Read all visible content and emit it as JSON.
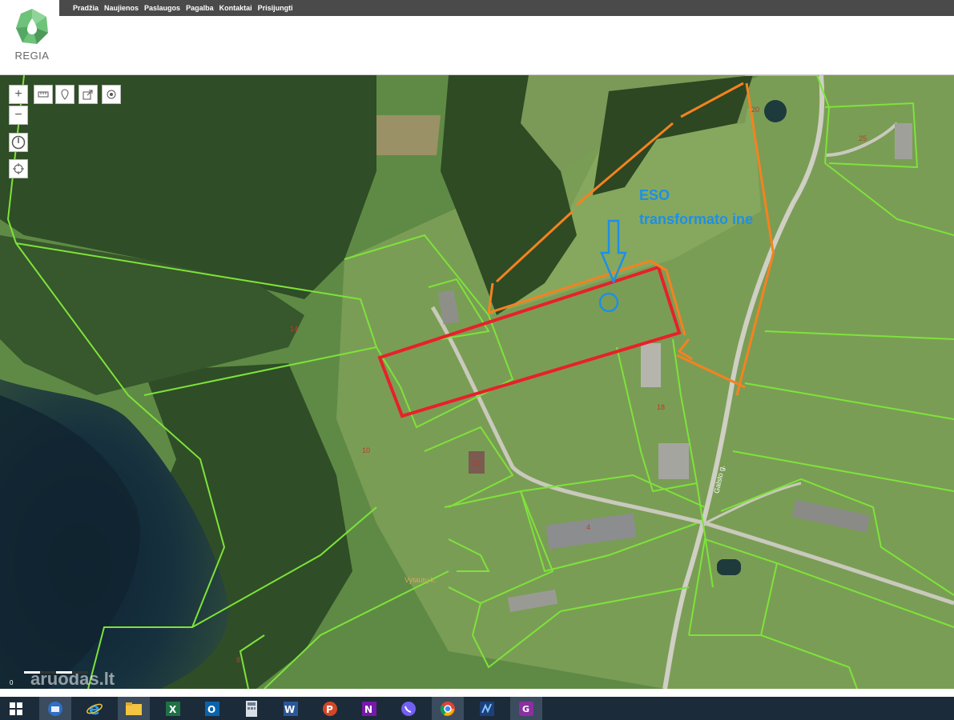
{
  "nav": {
    "items": [
      "Pradžia",
      "Naujienos",
      "Paslaugos",
      "Pagalba",
      "Kontaktai",
      "Prisijungti"
    ]
  },
  "logo": {
    "text": "REGIA"
  },
  "map": {
    "annotation_line1": "ESO",
    "annotation_line2": "transformato ine",
    "parcels": [
      "20",
      "25",
      "14",
      "10",
      "12",
      "18",
      "4",
      "8"
    ],
    "road_label": "Galsto g.",
    "village_label": "Vytautų k.",
    "watermark": "aruodas.lt",
    "scale_zero": "0",
    "controls": [
      "zoom-in",
      "zoom-out",
      "measure",
      "location-pin",
      "share",
      "target",
      "compass",
      "crosshair"
    ]
  },
  "taskbar": {
    "apps": [
      "windows-start",
      "thunderbird",
      "internet-explorer",
      "file-explorer",
      "excel",
      "outlook",
      "calculator",
      "word",
      "powerpoint",
      "onenote",
      "viber",
      "chrome",
      "audio-app",
      "pdf-app"
    ]
  },
  "colors": {
    "parcel_line": "#7de33a",
    "highlight_red": "#e8202a",
    "annotation_orange": "#f5821f",
    "annotation_blue": "#1e8fe6",
    "topbar": "#4a4a4a",
    "logo_green": "#6fc27a"
  }
}
